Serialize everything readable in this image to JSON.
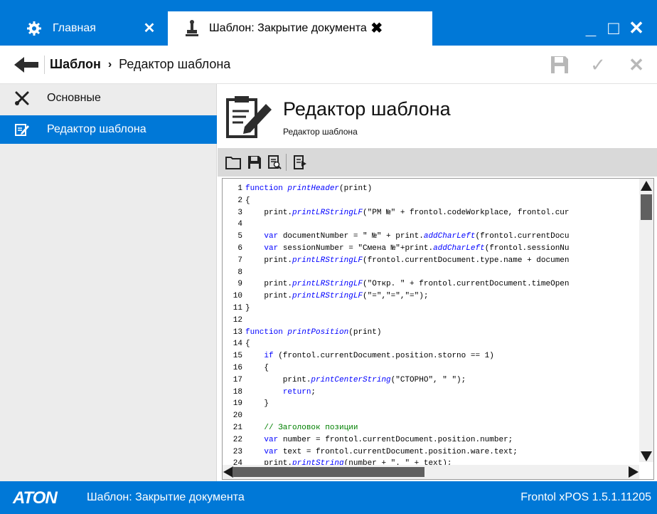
{
  "window": {
    "tabs": [
      {
        "label": "Главная",
        "icon": "gear-icon",
        "close": "✕"
      },
      {
        "label": "Шаблон: Закрытие документа",
        "icon": "stamp-icon",
        "close": "✖"
      }
    ],
    "controls": {
      "minimize": "_",
      "maximize": "□",
      "close": "✕"
    }
  },
  "navbar": {
    "breadcrumb": {
      "current": "Шаблон",
      "separator": "›",
      "child": "Редактор шаблона"
    },
    "actions": {
      "save": "save-icon",
      "apply": "✓",
      "cancel": "✕"
    }
  },
  "sidebar": {
    "items": [
      {
        "label": "Основные",
        "icon": "tools-icon",
        "active": false
      },
      {
        "label": "Редактор шаблона",
        "icon": "edit-icon",
        "active": true
      }
    ]
  },
  "header": {
    "title": "Редактор шаблона",
    "subtitle": "Редактор шаблона"
  },
  "editor_toolbar": [
    "open-icon",
    "save-icon",
    "preview-icon",
    "export-icon"
  ],
  "code": [
    {
      "n": "1",
      "text": "function printHeader(print)"
    },
    {
      "n": "2",
      "text": "{"
    },
    {
      "n": "3",
      "text": "    print.printLRStringLF(\"РМ №\" + frontol.codeWorkplace, frontol.cur"
    },
    {
      "n": "4",
      "text": ""
    },
    {
      "n": "5",
      "text": "    var documentNumber = \" №\" + print.addCharLeft(frontol.currentDocu"
    },
    {
      "n": "6",
      "text": "    var sessionNumber = \"Смена №\"+print.addCharLeft(frontol.sessionNu"
    },
    {
      "n": "7",
      "text": "    print.printLRStringLF(frontol.currentDocument.type.name + documen"
    },
    {
      "n": "8",
      "text": ""
    },
    {
      "n": "9",
      "text": "    print.printLRStringLF(\"Откр. \" + frontol.currentDocument.timeOpen"
    },
    {
      "n": "10",
      "text": "    print.printLRStringLF(\"=\",\"=\",\"=\");"
    },
    {
      "n": "11",
      "text": "}"
    },
    {
      "n": "12",
      "text": ""
    },
    {
      "n": "13",
      "text": "function printPosition(print)"
    },
    {
      "n": "14",
      "text": "{"
    },
    {
      "n": "15",
      "text": "    if (frontol.currentDocument.position.storno == 1)"
    },
    {
      "n": "16",
      "text": "    {"
    },
    {
      "n": "17",
      "text": "        print.printCenterString(\"СТОРНО\", \" \");"
    },
    {
      "n": "18",
      "text": "        return;"
    },
    {
      "n": "19",
      "text": "    }"
    },
    {
      "n": "20",
      "text": ""
    },
    {
      "n": "21",
      "text": "    // Заголовок позиции"
    },
    {
      "n": "22",
      "text": "    var number = frontol.currentDocument.position.number;"
    },
    {
      "n": "23",
      "text": "    var text = frontol.currentDocument.position.ware.text;"
    },
    {
      "n": "24",
      "text": "    print.printString(number + \". \" + text);"
    }
  ],
  "statusbar": {
    "logo": "ATON",
    "document": "Шаблон: Закрытие документа",
    "version": "Frontol xPOS 1.5.1.11205"
  },
  "colors": {
    "accent": "#0078d7",
    "sidebar": "#ececec",
    "keyword": "#0000ff",
    "comment": "#008000"
  }
}
